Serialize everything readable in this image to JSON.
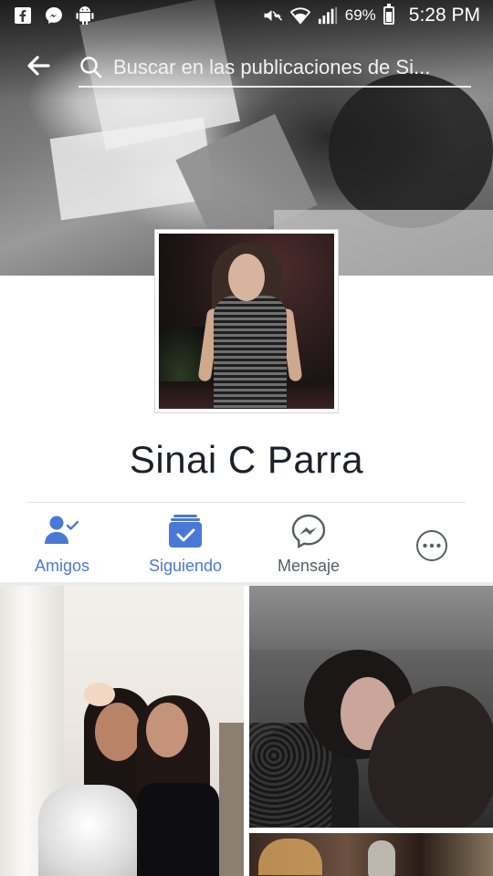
{
  "status_bar": {
    "battery_percent": "69%",
    "time": "5:28 PM",
    "left_icons": [
      "facebook-notification-icon",
      "messenger-notification-icon",
      "android-icon"
    ],
    "right_icons": [
      "mute-icon",
      "wifi-icon",
      "signal-icon",
      "battery-icon"
    ]
  },
  "header": {
    "back_icon": "back-arrow-icon",
    "search_icon": "search-icon",
    "search_placeholder": "Buscar en las publicaciones de Si..."
  },
  "profile": {
    "name": "Sinai C Parra"
  },
  "actions": [
    {
      "label": "Amigos",
      "icon": "friends-check-icon",
      "active": true
    },
    {
      "label": "Siguiendo",
      "icon": "following-check-icon",
      "active": true
    },
    {
      "label": "Mensaje",
      "icon": "messenger-icon",
      "active": false
    },
    {
      "label": "",
      "icon": "more-options-icon",
      "active": false
    }
  ],
  "colors": {
    "accent_blue": "#4a78d6",
    "text_dark": "#1d2129",
    "text_grey": "#5a5d63"
  }
}
